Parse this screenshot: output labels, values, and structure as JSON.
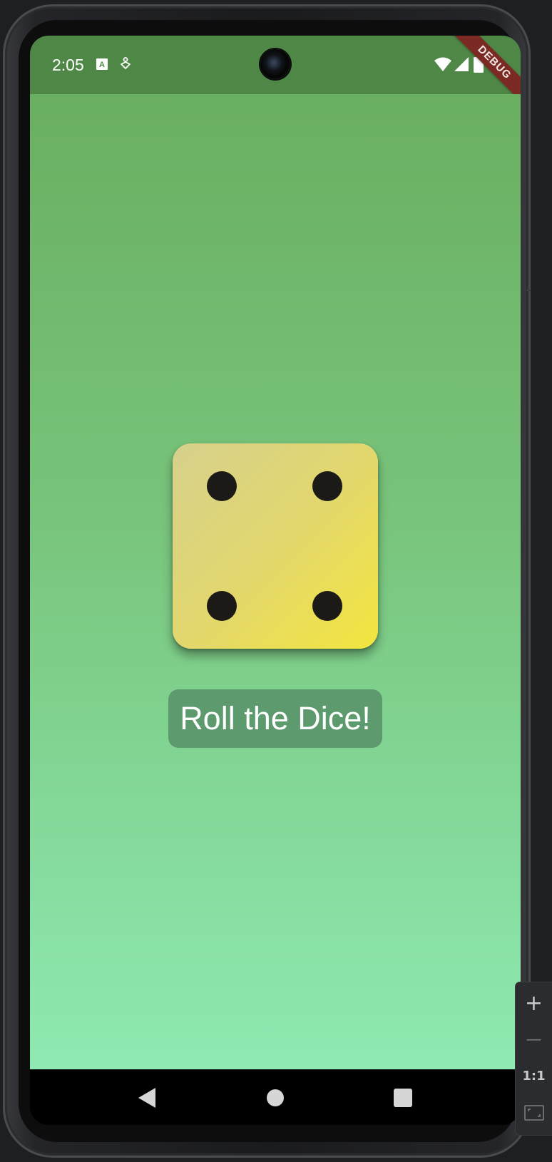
{
  "status_bar": {
    "time": "2:05",
    "icons": [
      "text-recognition-icon",
      "accessibility-icon",
      "wifi-icon",
      "cell-signal-icon",
      "battery-icon"
    ],
    "color": "#4f8747"
  },
  "debug_banner": {
    "label": "DEBUG"
  },
  "dice": {
    "value": 4,
    "pips": [
      "top-left",
      "top-right",
      "bottom-left",
      "bottom-right"
    ]
  },
  "roll_button": {
    "label": "Roll the Dice!"
  },
  "nav_bar": {
    "items": [
      "back-icon",
      "home-icon",
      "recents-icon"
    ]
  },
  "zoom_toolbar": {
    "zoom_in": "+",
    "zoom_out": "—",
    "actual_size": "1:1",
    "fit_icon": "fit-screen-icon"
  },
  "colors": {
    "background_top": "#6aaf61",
    "background_bottom": "#8eeab2",
    "dice_start": "#d6d08c",
    "dice_end": "#f3e53e",
    "pip": "#1c1a16",
    "button": "#5d9b6e"
  }
}
